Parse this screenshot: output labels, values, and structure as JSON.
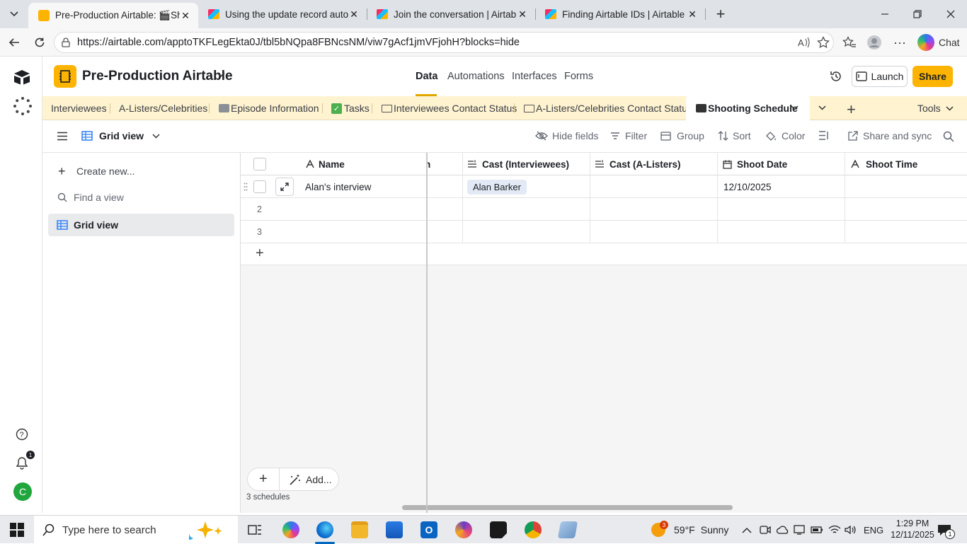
{
  "browser": {
    "tabs": [
      {
        "title": "Pre-Production Airtable: 🎬Shooti",
        "active": true
      },
      {
        "title": "Using the update record automati",
        "active": false
      },
      {
        "title": "Join the conversation | Airtable Co",
        "active": false
      },
      {
        "title": "Finding Airtable IDs | Airtable Supp",
        "active": false
      }
    ],
    "url": "https://airtable.com/apptoTKFLegEkta0J/tbl5bNQpa8FBNcsNM/viw7gAcf1jmVFjohH?blocks=hide",
    "chat_label": "Chat"
  },
  "app": {
    "base_name": "Pre-Production Airtable",
    "nav": [
      "Data",
      "Automations",
      "Interfaces",
      "Forms"
    ],
    "launch_label": "Launch",
    "share_label": "Share",
    "accent": "#fcb400",
    "avatar_letter": "C",
    "notification_count": "1"
  },
  "tables": {
    "items": [
      "Interviewees",
      "A-Listers/Celebrities",
      "Episode Information",
      "Tasks",
      "Interviewees Contact Status",
      "A-Listers/Celebrities Contact Status",
      "Shooting Schedule"
    ],
    "tools_label": "Tools"
  },
  "viewbar": {
    "view_name": "Grid view",
    "hide_fields": "Hide fields",
    "filter": "Filter",
    "group": "Group",
    "sort": "Sort",
    "color": "Color",
    "share_sync": "Share and sync"
  },
  "sidebar": {
    "create_new": "Create new...",
    "find_placeholder": "Find a view",
    "views": [
      "Grid view"
    ]
  },
  "grid": {
    "columns": [
      "Name",
      "n",
      "Cast (Interviewees)",
      "Cast (A-Listers)",
      "Shoot Date",
      "Shoot Time"
    ],
    "rows": [
      {
        "num": "",
        "name": "Alan's interview",
        "cast_interviewees": "Alan Barker",
        "cast_alisters": "",
        "shoot_date": "12/10/2025",
        "shoot_time": ""
      },
      {
        "num": "2",
        "name": "",
        "cast_interviewees": "",
        "cast_alisters": "",
        "shoot_date": "",
        "shoot_time": ""
      },
      {
        "num": "3",
        "name": "",
        "cast_interviewees": "",
        "cast_alisters": "",
        "shoot_date": "",
        "shoot_time": ""
      }
    ],
    "add_label": "Add...",
    "record_count": "3 schedules"
  },
  "taskbar": {
    "search_placeholder": "Type here to search",
    "weather_temp": "59°F",
    "weather_desc": "Sunny",
    "weather_badge": "3",
    "language": "ENG",
    "time": "1:29 PM",
    "date": "12/11/2025",
    "notif_count": "1"
  }
}
